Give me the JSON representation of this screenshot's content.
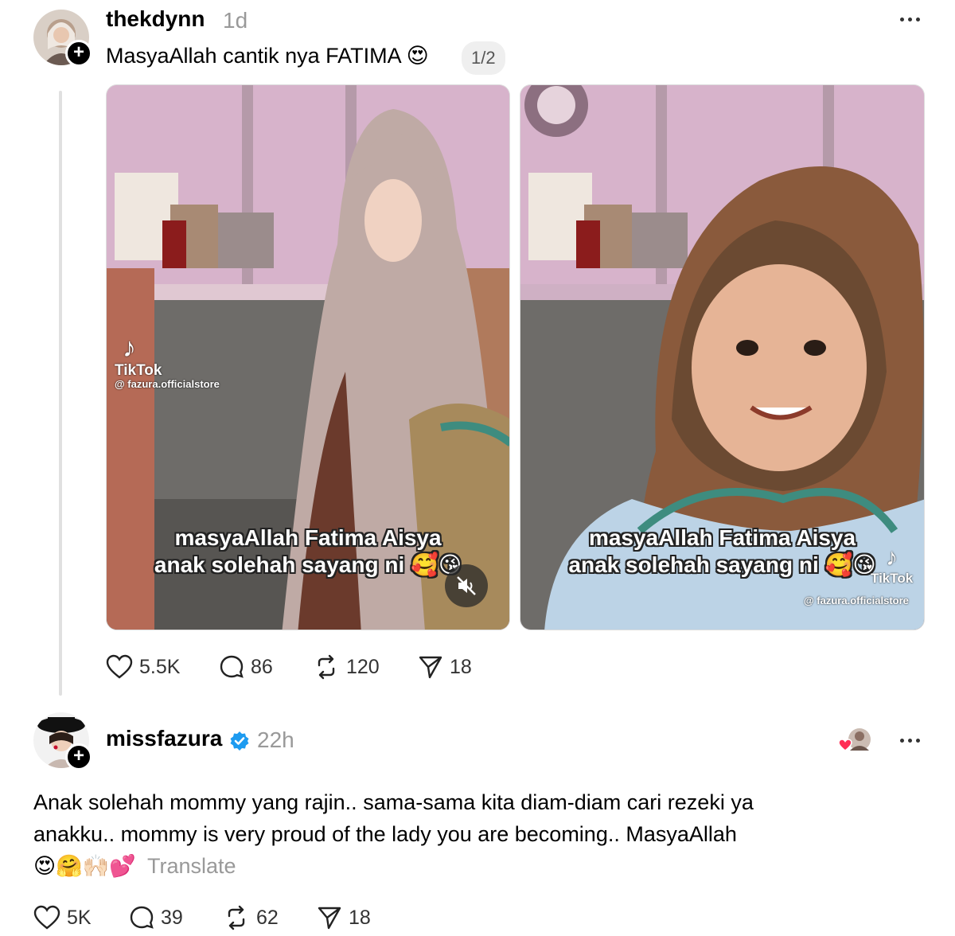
{
  "post": {
    "username": "thekdynn",
    "time": "1d",
    "text": "MasyaAllah cantik nya FATIMA",
    "text_emoji": "😍",
    "media_counter": "1/2",
    "media": [
      {
        "caption_line1": "masyaAllah Fatima Aisya",
        "caption_line2": "anak solehah sayang ni",
        "caption_emoji": "🥰😘",
        "tiktok_label": "TikTok",
        "tiktok_handle": "@ fazura.officialstore"
      },
      {
        "caption_line1": "masyaAllah Fatima Aisya",
        "caption_line2": "anak solehah sayang ni",
        "caption_emoji": "🥰😘",
        "tiktok_label": "TikTok",
        "tiktok_handle": "@ fazura.officialstore"
      }
    ],
    "actions": {
      "likes": "5.5K",
      "comments": "86",
      "reposts": "120",
      "shares": "18"
    }
  },
  "reply": {
    "username": "missfazura",
    "time": "22h",
    "text_line1": "Anak solehah mommy yang rajin.. sama-sama kita diam-diam cari rezeki ya",
    "text_line2": "anakku.. mommy is very proud of the lady you are becoming.. MasyaAllah",
    "emojis": "😍🤗🙌🏻💕",
    "translate_label": "Translate",
    "actions": {
      "likes": "5K",
      "comments": "39",
      "reposts": "62",
      "shares": "18"
    }
  },
  "colors": {
    "muted_text": "#999999",
    "verified": "#1d9bf0",
    "thread_line": "#e0e0e0",
    "like_heart": "#ff2d55"
  }
}
